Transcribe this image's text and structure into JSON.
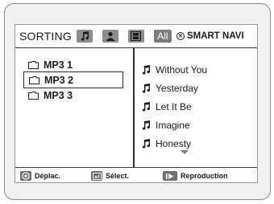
{
  "header": {
    "title": "SORTING",
    "modes": [
      {
        "icon": "music-note-icon"
      },
      {
        "icon": "person-icon"
      },
      {
        "icon": "film-icon"
      },
      {
        "label": "All"
      }
    ],
    "smart_navi_label": "SMART NAVI",
    "smart_navi_icon": "circle-x-icon"
  },
  "folders": [
    {
      "label": "MP3 1",
      "selected": false
    },
    {
      "label": "MP3 2",
      "selected": true
    },
    {
      "label": "MP3 3",
      "selected": false
    }
  ],
  "tracks": [
    {
      "title": "Without You"
    },
    {
      "title": "Yesterday"
    },
    {
      "title": "Let It Be"
    },
    {
      "title": "Imagine"
    },
    {
      "title": "Honesty"
    }
  ],
  "footer": {
    "move_label": "Déplac.",
    "select_label": "Sélect.",
    "play_label": "Reproduction"
  }
}
